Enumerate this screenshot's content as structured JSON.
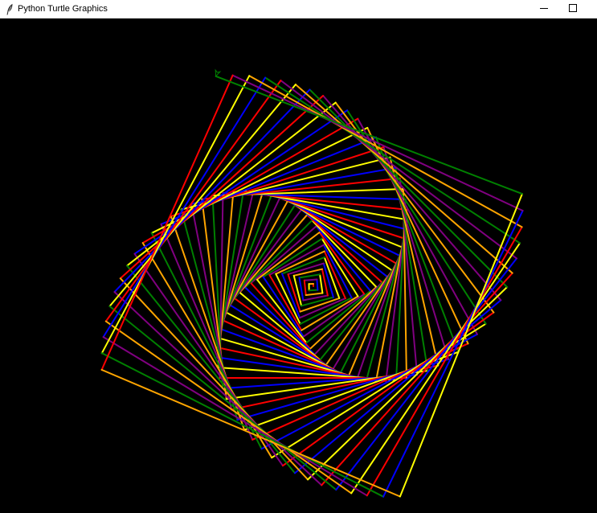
{
  "window": {
    "title": "Python Turtle Graphics"
  },
  "icons": {
    "app": "feather-icon",
    "minimize": "minimize-icon",
    "maximize": "maximize-icon"
  },
  "canvas": {
    "background": "#000000",
    "pen_colors": [
      "#ff0000",
      "#ffa500",
      "#ffff00",
      "#008000",
      "#0000ff",
      "#800080"
    ],
    "turtle_color": "#008000"
  }
}
